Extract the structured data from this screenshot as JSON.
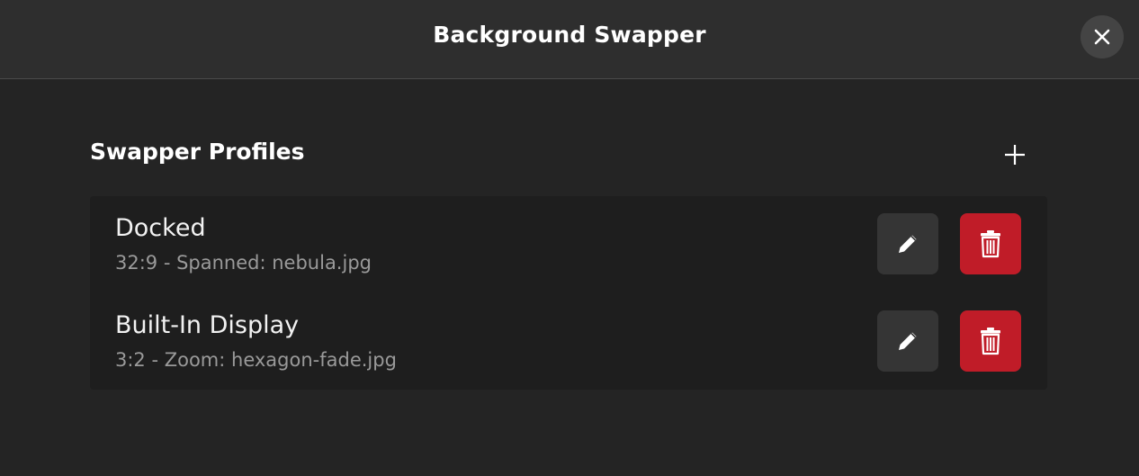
{
  "window": {
    "title": "Background Swapper",
    "close_icon": "close-icon"
  },
  "section": {
    "title": "Swapper Profiles",
    "add_icon": "plus-icon"
  },
  "profiles": [
    {
      "name": "Docked",
      "details": "32:9 - Spanned: nebula.jpg"
    },
    {
      "name": "Built-In Display",
      "details": "3:2 - Zoom: hexagon-fade.jpg"
    }
  ],
  "row_actions": {
    "edit_icon": "pencil-icon",
    "delete_icon": "trash-icon"
  },
  "colors": {
    "window_bg": "#242424",
    "headerbar_bg": "#2e2e2e",
    "list_bg": "#1e1e1e",
    "edit_button_bg": "#353535",
    "destructive": "#c01c28",
    "secondary_text": "#9a9a9a"
  }
}
